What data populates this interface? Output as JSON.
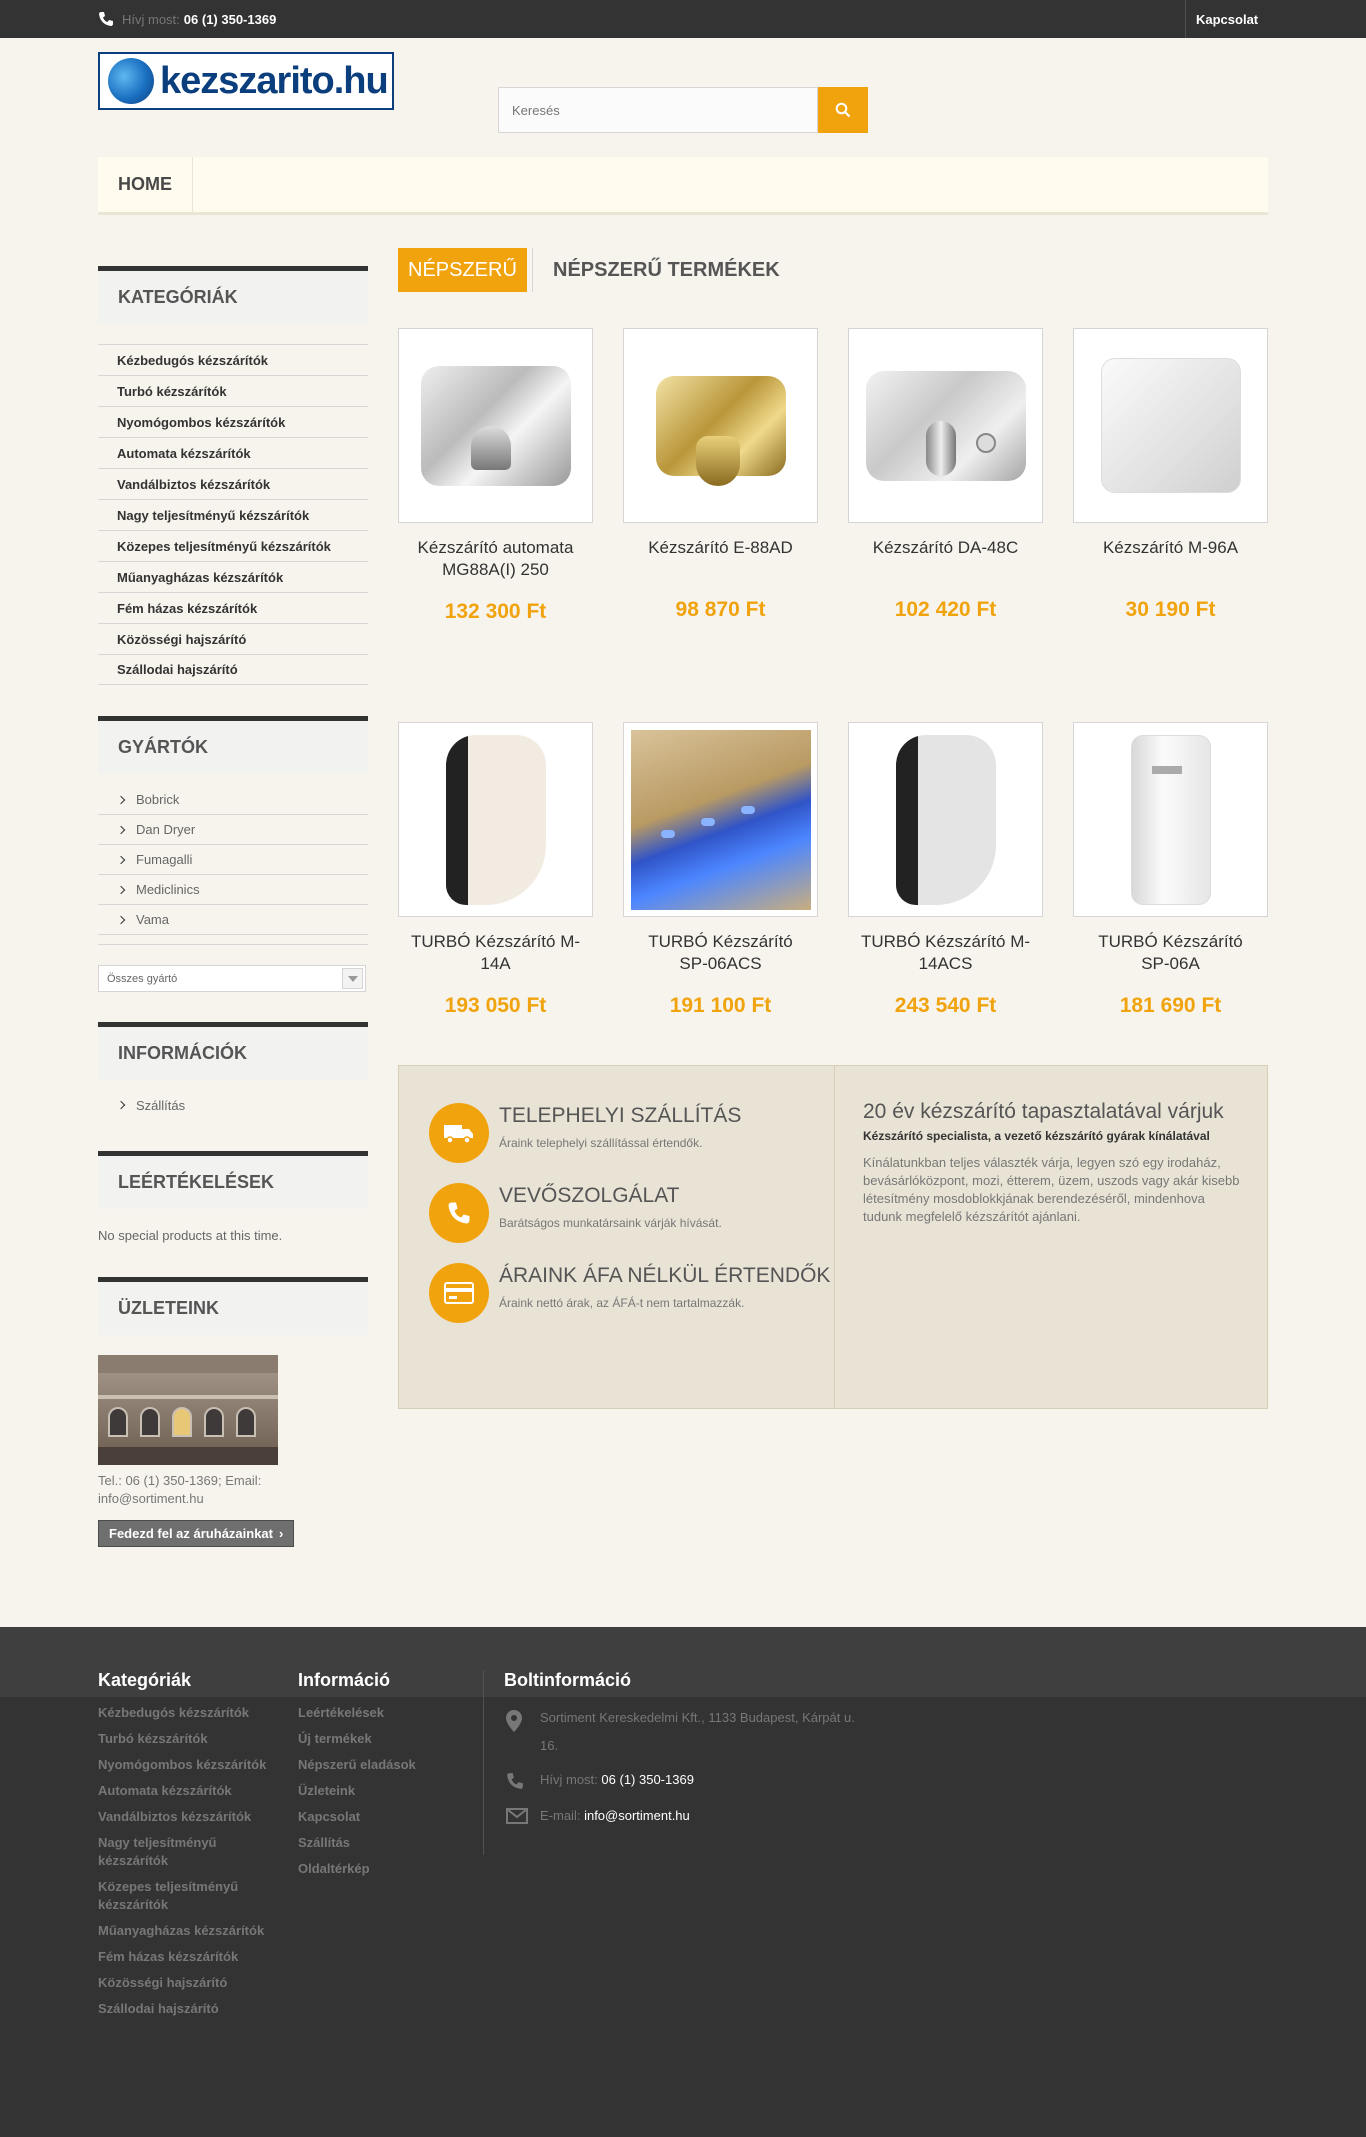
{
  "topbar": {
    "phone_label": "Hívj most:",
    "phone_number": "06 (1) 350-1369",
    "contact": "Kapcsolat"
  },
  "logo": {
    "text": "kezszarito.hu"
  },
  "search": {
    "placeholder": "Keresés"
  },
  "menu": {
    "home": "HOME"
  },
  "sidebar": {
    "categories_title": "KATEGÓRIÁK",
    "categories": [
      "Kézbedugós kézszárítók",
      "Turbó kézszárítók",
      "Nyomógombos kézszárítók",
      "Automata kézszárítók",
      "Vandálbiztos kézszárítók",
      "Nagy teljesítményű kézszárítók",
      "Közepes teljesítményű kézszárítók",
      "Műanyagházas kézszárítók",
      "Fém házas kézszárítók",
      "Közösségi hajszárító",
      "Szállodai hajszárító"
    ],
    "manufacturers_title": "GYÁRTÓK",
    "manufacturers": [
      "Bobrick",
      "Dan Dryer",
      "Fumagalli",
      "Mediclinics",
      "Vama"
    ],
    "manufacturer_select": "Összes gyártó",
    "info_title": "INFORMÁCIÓK",
    "info_link": "Szállítás",
    "reviews_title": "LEÉRTÉKELÉSEK",
    "no_special": "No special products at this time.",
    "stores_title": "ÜZLETEINK",
    "store_text": "Tel.: 06 (1) 350-1369; Email: info@sortiment.hu",
    "store_button": "Fedezd fel az áruházainkat"
  },
  "tabs": {
    "active": "NÉPSZERŰ",
    "inactive": "NÉPSZERŰ TERMÉKEK"
  },
  "products": [
    {
      "name": "Kézszárító automata MG88A(I) 250",
      "price": "132 300 Ft"
    },
    {
      "name": "Kézszárító E-88AD",
      "price": "98 870 Ft"
    },
    {
      "name": "Kézszárító DA-48C",
      "price": "102 420 Ft"
    },
    {
      "name": "Kézszárító M-96A",
      "price": "30 190 Ft"
    },
    {
      "name": "TURBÓ Kézszárító M-14A",
      "price": "193 050 Ft"
    },
    {
      "name": "TURBÓ Kézszárító SP-06ACS",
      "price": "191 100 Ft"
    },
    {
      "name": "TURBÓ Kézszárító M-14ACS",
      "price": "243 540 Ft"
    },
    {
      "name": "TURBÓ Kézszárító SP-06A",
      "price": "181 690 Ft"
    }
  ],
  "features": [
    {
      "title": "TELEPHELYI SZÁLLÍTÁS",
      "text": "Áraink telephelyi szállítással értendők.",
      "icon": "truck-icon"
    },
    {
      "title": "VEVŐSZOLGÁLAT",
      "text": "Barátságos munkatársaink várják hívását.",
      "icon": "phone-icon"
    },
    {
      "title": "ÁRAINK ÁFA NÉLKÜL ÉRTENDŐK",
      "text": "Áraink nettó árak, az ÁFÁ-t nem tartalmazzák.",
      "icon": "credit-card-icon"
    }
  ],
  "about": {
    "heading": "20 év kézszárító tapasztalatával várjuk",
    "bold": "Kézszárító specialista, a vezető kézszárító gyárak kínálatával",
    "text": "Kínálatunkban teljes választék várja, legyen szó egy irodaház, bevásárlóközpont, mozi, étterem, üzem, uszods vagy akár kisebb létesítmény mosdoblokkjának berendezéséről, mindenhova tudunk megfelelő kézszárítót ajánlani."
  },
  "footer": {
    "categories_title": "Kategóriák",
    "categories": [
      "Kézbedugós kézszárítók",
      "Turbó kézszárítók",
      "Nyomógombos kézszárítók",
      "Automata kézszárítók",
      "Vandálbiztos kézszárítók",
      "Nagy teljesítményű kézszárítók",
      "Közepes teljesítményű kézszárítók",
      "Műanyagházas kézszárítók",
      "Fém házas kézszárítók",
      "Közösségi hajszárító",
      "Szállodai hajszárító"
    ],
    "info_title": "Információ",
    "info": [
      "Leértékelések",
      "Új termékek",
      "Népszerű eladások",
      "Üzleteink",
      "Kapcsolat",
      "Szállítás",
      "Oldaltérkép"
    ],
    "store_title": "Boltinformáció",
    "address": "Sortiment Kereskedelmi Kft., 1133 Budapest, Kárpát u. 16.",
    "phone_label": "Hívj most:",
    "phone": "06 (1) 350-1369",
    "email_label": "E-mail:",
    "email": "info@sortiment.hu"
  },
  "colors": {
    "accent": "#f1a30e",
    "dark": "#333333",
    "brand": "#0b3e7c"
  }
}
